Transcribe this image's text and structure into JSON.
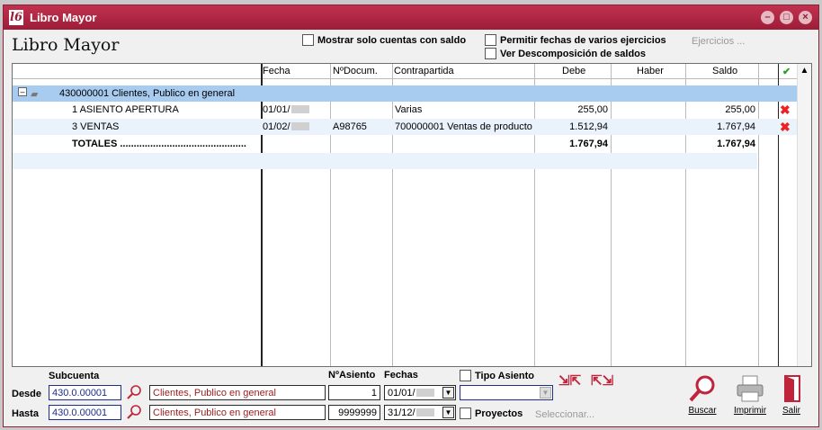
{
  "window": {
    "title": "Libro Mayor",
    "logo": "l6"
  },
  "page_title": "Libro Mayor",
  "options": {
    "solo_saldo": "Mostrar solo cuentas con saldo",
    "varios_ejercicios": "Permitir fechas de varios ejercicios",
    "descomposicion": "Ver Descomposición de saldos",
    "ejercicios": "Ejercicios ..."
  },
  "columns": [
    "Fecha",
    "NºDocum.",
    "Contrapartida",
    "Debe",
    "Haber",
    "Saldo"
  ],
  "account": {
    "label": "430000001 Clientes, Publico en general"
  },
  "rows": [
    {
      "desc": "1 ASIENTO APERTURA",
      "fecha": "01/01/",
      "doc": "",
      "contrapartida": "Varias",
      "debe": "255,00",
      "haber": "",
      "saldo": "255,00"
    },
    {
      "desc": "3 VENTAS",
      "fecha": "01/02/",
      "doc": "A98765",
      "contrapartida": "700000001 Ventas de producto",
      "debe": "1.512,94",
      "haber": "",
      "saldo": "1.767,94"
    }
  ],
  "totals": {
    "label": "TOTALES ..............................................",
    "debe": "1.767,94",
    "saldo": "1.767,94"
  },
  "filters": {
    "subcuenta_label": "Subcuenta",
    "nasiento_label": "NºAsiento",
    "fechas_label": "Fechas",
    "tipo_asiento": "Tipo Asiento",
    "proyectos": "Proyectos",
    "seleccionar": "Seleccionar...",
    "desde": {
      "label": "Desde",
      "cuenta": "430.0.00001",
      "nombre": "Clientes, Publico en general",
      "asiento": "1",
      "fecha": "01/01/"
    },
    "hasta": {
      "label": "Hasta",
      "cuenta": "430.0.00001",
      "nombre": "Clientes, Publico en general",
      "asiento": "9999999",
      "fecha": "31/12/"
    }
  },
  "actions": {
    "buscar": "Buscar",
    "imprimir": "Imprimir",
    "salir": "Salir"
  },
  "colors": {
    "title_bar": "#b0233f",
    "accent_red": "#c0243a",
    "row_highlight": "#a8cbf0"
  }
}
